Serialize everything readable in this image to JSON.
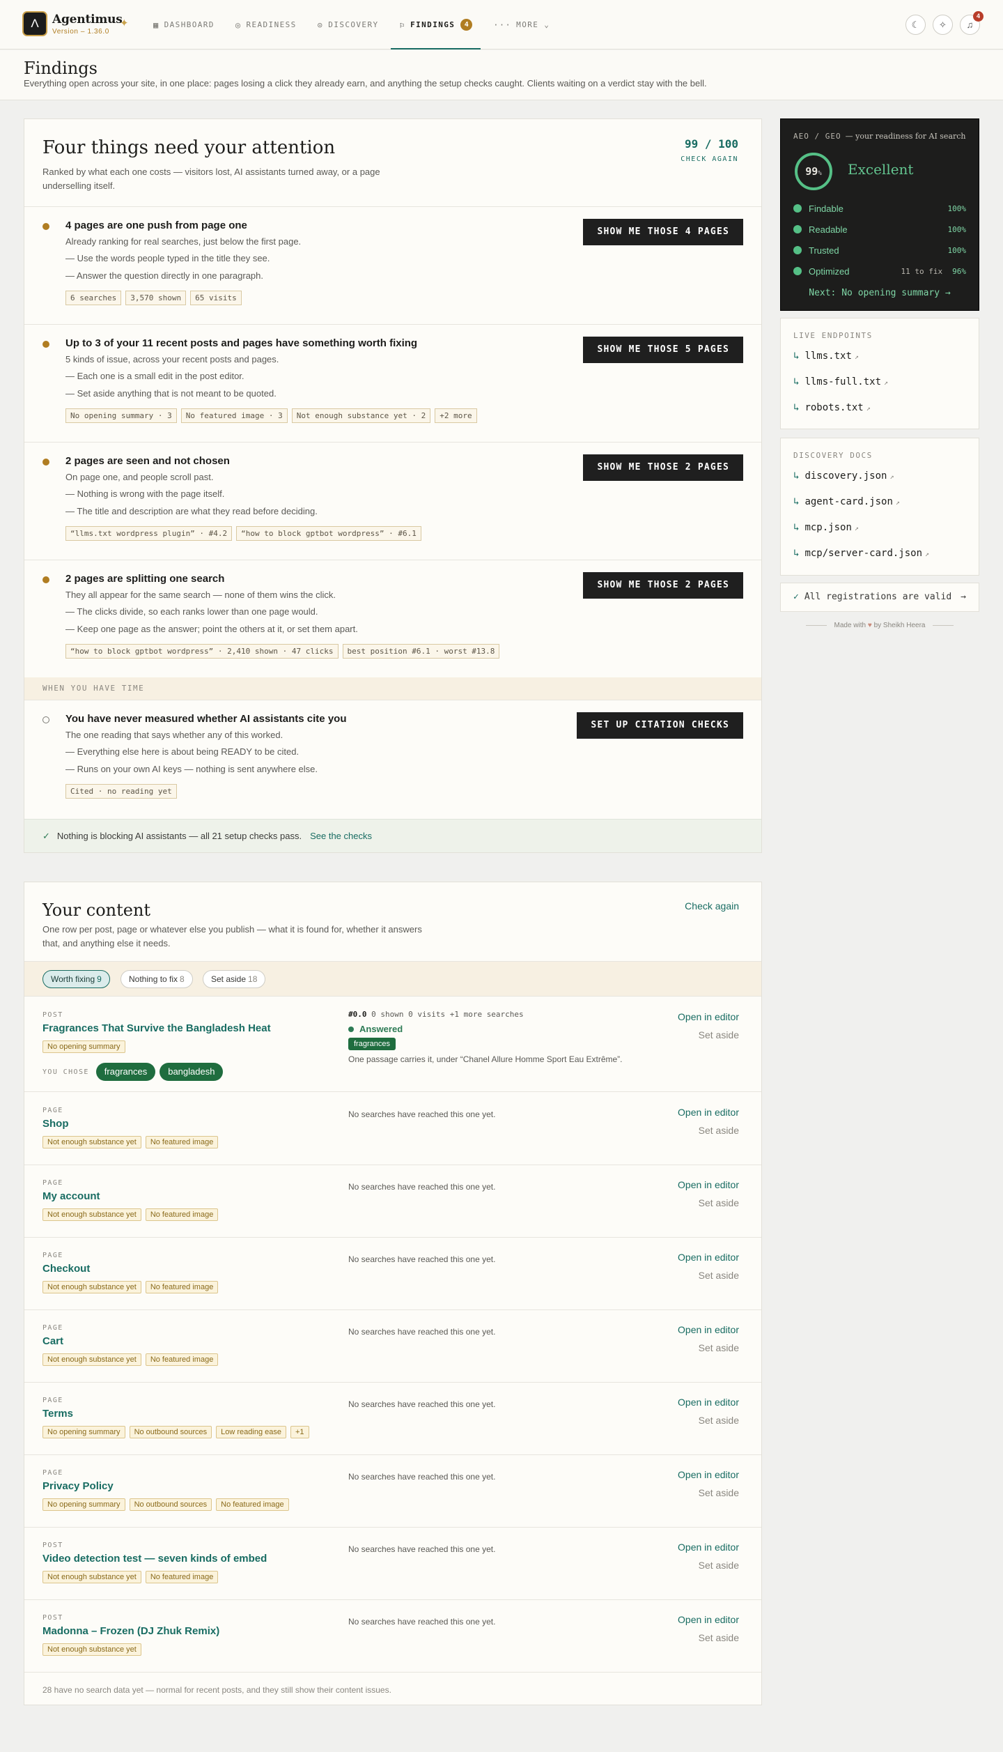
{
  "app": {
    "name": "Agentimus",
    "version": "Version – 1.36.0"
  },
  "nav": [
    {
      "icon": "▦",
      "label": "DASHBOARD"
    },
    {
      "icon": "◎",
      "label": "READINESS"
    },
    {
      "icon": "⊙",
      "label": "DISCOVERY"
    },
    {
      "icon": "⚐",
      "label": "FINDINGS",
      "badge": "4"
    },
    {
      "icon": "···",
      "label": "MORE ⌄"
    }
  ],
  "notifications_count": "4",
  "page": {
    "title": "Findings",
    "subtitle": "Everything open across your site, in one place: pages losing a click they already earn, and anything the setup checks caught. Clients waiting on a verdict stay with the bell."
  },
  "findings": {
    "title": "Four things need your attention",
    "subtitle": "Ranked by what each one costs — visitors lost, AI assistants turned away, or a page underselling itself.",
    "score": "99 / 100",
    "score_action": "CHECK AGAIN",
    "issues": [
      {
        "title": "4 pages are one push from page one",
        "desc": "Already ranking for real searches, just below the first page.",
        "bullets": [
          "— Use the words people typed in the title they see.",
          "— Answer the question directly in one paragraph."
        ],
        "chips": [
          "6 searches",
          "3,570 shown",
          "65 visits"
        ],
        "action": "SHOW ME THOSE 4 PAGES"
      },
      {
        "title": "Up to 3 of your 11 recent posts and pages have something worth fixing",
        "desc": "5 kinds of issue, across your recent posts and pages.",
        "bullets": [
          "— Each one is a small edit in the post editor.",
          "— Set aside anything that is not meant to be quoted."
        ],
        "chips": [
          "No opening summary · 3",
          "No featured image · 3",
          "Not enough substance yet · 2",
          "+2 more"
        ],
        "action": "SHOW ME THOSE 5 PAGES"
      },
      {
        "title": "2 pages are seen and not chosen",
        "desc": "On page one, and people scroll past.",
        "bullets": [
          "— Nothing is wrong with the page itself.",
          "— The title and description are what they read before deciding."
        ],
        "chips": [
          "“llms.txt wordpress plugin” · #4.2",
          "“how to block gptbot wordpress” · #6.1"
        ],
        "action": "SHOW ME THOSE 2 PAGES"
      },
      {
        "title": "2 pages are splitting one search",
        "desc": "They all appear for the same search — none of them wins the click.",
        "bullets": [
          "— The clicks divide, so each ranks lower than one page would.",
          "— Keep one page as the answer; point the others at it, or set them apart."
        ],
        "chips": [
          "“how to block gptbot wordpress” · 2,410 shown · 47 clicks",
          "best position #6.1 · worst #13.8"
        ],
        "action": "SHOW ME THOSE 2 PAGES"
      }
    ],
    "later_label": "WHEN YOU HAVE TIME",
    "later": {
      "title": "You have never measured whether AI assistants cite you",
      "desc": "The one reading that says whether any of this worked.",
      "bullets": [
        "— Everything else here is about being READY to be cited.",
        "— Runs on your own AI keys — nothing is sent anywhere else."
      ],
      "chips": [
        "Cited · no reading yet"
      ],
      "action": "SET UP CITATION CHECKS"
    },
    "ok_text": "Nothing is blocking AI assistants — all 21 setup checks pass.",
    "ok_link": "See the checks"
  },
  "aeo": {
    "label": "AEO / GEO",
    "tagline": "— your readiness for AI search",
    "score": 99,
    "score_unit": "%",
    "verdict": "Excellent",
    "metrics": [
      {
        "name": "Findable",
        "value": "100%"
      },
      {
        "name": "Readable",
        "value": "100%"
      },
      {
        "name": "Trusted",
        "value": "100%"
      },
      {
        "name": "Optimized",
        "fix": "11 to fix",
        "value": "96%"
      }
    ],
    "next": "Next: No opening summary →",
    "colors": {
      "good": "#55c086",
      "track": "#3a3a38"
    }
  },
  "endpoints": {
    "title": "LIVE ENDPOINTS",
    "items": [
      "llms.txt",
      "llms-full.txt",
      "robots.txt"
    ]
  },
  "docs": {
    "title": "DISCOVERY DOCS",
    "items": [
      "discovery.json",
      "agent-card.json",
      "mcp.json",
      "mcp/server-card.json"
    ]
  },
  "registrations": "All registrations are valid",
  "madewith": {
    "pre": "Made with",
    "post": "by Sheikh Heera"
  },
  "content": {
    "title": "Your content",
    "subtitle": "One row per post, page or whatever else you publish — what it is found for, whether it answers that, and anything else it needs.",
    "check_again": "Check again",
    "filters": [
      {
        "label": "Worth fixing",
        "count": "9"
      },
      {
        "label": "Nothing to fix",
        "count": "8"
      },
      {
        "label": "Set aside",
        "count": "18"
      }
    ],
    "open_label": "Open in editor",
    "aside_label": "Set aside",
    "no_search": "No searches have reached this one yet.",
    "featured": {
      "type": "POST",
      "title": "Fragrances That Survive the Bangladesh Heat",
      "tags": [
        "No opening summary"
      ],
      "chose_label": "YOU CHOSE",
      "chose": [
        "fragrances",
        "bangladesh"
      ],
      "stat_pos": "#0.0",
      "stat_rest": "0 shown  0 visits  +1 more searches",
      "answered": "Answered",
      "answered_tag": "fragrances",
      "passage": "One passage carries it, under “Chanel Allure Homme Sport Eau Extrême”."
    },
    "rows": [
      {
        "type": "PAGE",
        "title": "Shop",
        "tags": [
          "Not enough substance yet",
          "No featured image"
        ]
      },
      {
        "type": "PAGE",
        "title": "My account",
        "tags": [
          "Not enough substance yet",
          "No featured image"
        ]
      },
      {
        "type": "PAGE",
        "title": "Checkout",
        "tags": [
          "Not enough substance yet",
          "No featured image"
        ]
      },
      {
        "type": "PAGE",
        "title": "Cart",
        "tags": [
          "Not enough substance yet",
          "No featured image"
        ]
      },
      {
        "type": "PAGE",
        "title": "Terms",
        "tags": [
          "No opening summary",
          "No outbound sources",
          "Low reading ease",
          "+1"
        ]
      },
      {
        "type": "PAGE",
        "title": "Privacy Policy",
        "tags": [
          "No opening summary",
          "No outbound sources",
          "No featured image"
        ]
      },
      {
        "type": "POST",
        "title": "Video detection test — seven kinds of embed",
        "tags": [
          "Not enough substance yet",
          "No featured image"
        ]
      },
      {
        "type": "POST",
        "title": "Madonna – Frozen (DJ Zhuk Remix)",
        "tags": [
          "Not enough substance yet"
        ]
      }
    ],
    "footnote": "28 have no search data yet — normal for recent posts, and they still show their content issues."
  }
}
